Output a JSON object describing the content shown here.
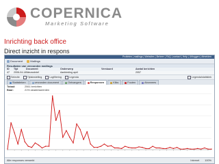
{
  "brand": {
    "name": "COPERNICA",
    "tagline": "Marketing Software",
    "mark_colors": [
      "#cc1b1b",
      "#e57d7d",
      "#8a8a8a",
      "#c9c9c9"
    ]
  },
  "slide": {
    "title": "Inrichting back office",
    "subtitle": "Direct inzicht in respons"
  },
  "app": {
    "topbar_text": "Profielen | mailings | Websites | Beheer | FAQ | contact | Help | Uitloggen | Afmelden",
    "toolbar": [
      {
        "label": "Document",
        "icon": "document-icon"
      },
      {
        "label": "Mailings",
        "icon": "mail-icon"
      }
    ],
    "section_title": "Resultaten van verzonden mailings",
    "table_headers": [
      "ID",
      "Tijd",
      "Document",
      "Onderwerp",
      "Verstuurd",
      "Aantal berichten"
    ],
    "table_row": [
      "47",
      "2006-04-14 13:00",
      "Nieuwsbrief",
      "Aanbieding april",
      "",
      "2057"
    ],
    "filters": [
      {
        "label": "Selectie",
        "checked": true
      },
      {
        "label": "Tijdsinstelling",
        "checked": false
      },
      {
        "label": "Logfiltering",
        "checked": false
      },
      {
        "label": "Legenda",
        "checked": true
      }
    ],
    "filter_right": "Legenda/statistiek",
    "tabs": [
      {
        "label": "Statistieken",
        "active": false
      },
      {
        "label": "verzonden document",
        "active": false
      },
      {
        "label": "Ontvangers",
        "active": false
      },
      {
        "label": "Responsen",
        "active": true
      },
      {
        "label": "Kliks",
        "active": false
      },
      {
        "label": "Fouten",
        "active": false
      },
      {
        "label": "Abonnees",
        "active": false
      }
    ],
    "summary": [
      {
        "key": "Totaal:",
        "value": "2061 berichten"
      },
      {
        "key": "Baar:",
        "value": "21% geadresseerden"
      }
    ],
    "status_left": "Alle responses verwerkt",
    "status_zone": "Internet",
    "status_zoom": "100%"
  },
  "chart_data": {
    "type": "line",
    "series_color": "#d01010",
    "series": [
      {
        "name": "",
        "values": [
          1,
          48,
          30,
          10,
          36,
          14,
          6,
          4,
          12,
          8,
          3,
          6,
          6,
          96,
          52,
          70,
          22,
          34,
          22,
          12,
          46,
          36,
          18,
          32,
          10,
          4,
          4,
          6,
          10,
          6,
          7,
          3,
          3,
          2,
          6,
          4,
          3,
          3,
          5,
          4,
          2,
          2,
          6,
          3,
          3,
          2,
          2,
          4,
          2,
          4,
          1,
          1,
          2,
          1,
          1,
          2,
          1,
          3,
          1,
          1
        ]
      }
    ],
    "ylim": [
      0,
      100
    ],
    "xlabel": "",
    "ylabel": "",
    "grid": true
  }
}
